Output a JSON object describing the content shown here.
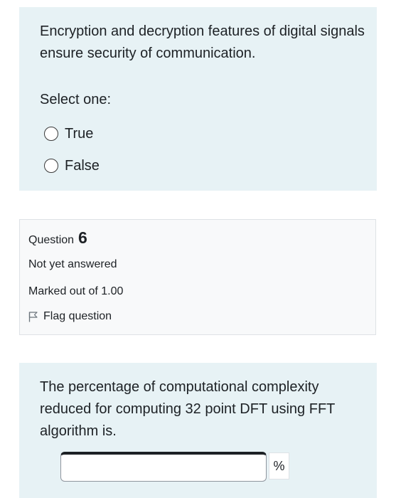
{
  "question5": {
    "text": "Encryption and decryption features of digital signals ensure security of communication.",
    "prompt": "Select one:",
    "options": [
      {
        "label": "True",
        "selected": false
      },
      {
        "label": "False",
        "selected": false
      }
    ]
  },
  "question6_info": {
    "label": "Question",
    "number": "6",
    "status": "Not yet answered",
    "marks": "Marked out of 1.00",
    "flag_label": "Flag question",
    "flag_icon": "flag-icon"
  },
  "question6": {
    "text": "The percentage of computational complexity reduced for computing 32 point DFT using FFT algorithm is.",
    "answer_value": "",
    "unit": "%"
  },
  "colors": {
    "question_bg": "#e7f2f5",
    "info_bg": "#f8f9fa",
    "text": "#1d2125"
  }
}
